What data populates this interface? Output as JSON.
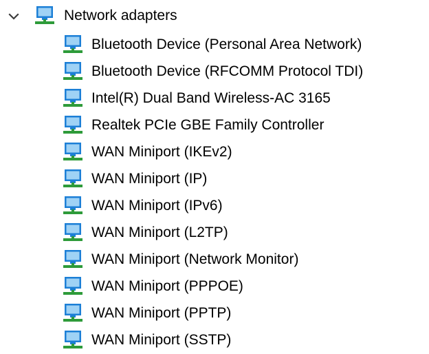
{
  "device_tree": {
    "category": {
      "label": "Network adapters",
      "expanded": true,
      "expander_icon": "chevron-down-icon",
      "icon": "network-adapter-icon"
    },
    "devices": [
      {
        "label": "Bluetooth Device (Personal Area Network)",
        "icon": "network-adapter-icon"
      },
      {
        "label": "Bluetooth Device (RFCOMM Protocol TDI)",
        "icon": "network-adapter-icon"
      },
      {
        "label": "Intel(R) Dual Band Wireless-AC 3165",
        "icon": "network-adapter-icon"
      },
      {
        "label": "Realtek PCIe GBE Family Controller",
        "icon": "network-adapter-icon"
      },
      {
        "label": "WAN Miniport (IKEv2)",
        "icon": "network-adapter-icon"
      },
      {
        "label": "WAN Miniport (IP)",
        "icon": "network-adapter-icon"
      },
      {
        "label": "WAN Miniport (IPv6)",
        "icon": "network-adapter-icon"
      },
      {
        "label": "WAN Miniport (L2TP)",
        "icon": "network-adapter-icon"
      },
      {
        "label": "WAN Miniport (Network Monitor)",
        "icon": "network-adapter-icon"
      },
      {
        "label": "WAN Miniport (PPPOE)",
        "icon": "network-adapter-icon"
      },
      {
        "label": "WAN Miniport (PPTP)",
        "icon": "network-adapter-icon"
      },
      {
        "label": "WAN Miniport (SSTP)",
        "icon": "network-adapter-icon"
      }
    ]
  },
  "colors": {
    "monitor_frame": "#1c7fd6",
    "monitor_screen": "#9fd2f5",
    "network_cable": "#2e9b3a",
    "chevron": "#3c3c3c"
  }
}
